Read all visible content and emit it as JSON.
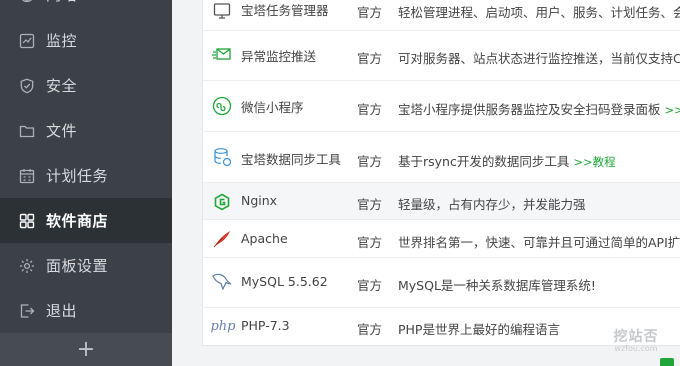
{
  "sidebar": {
    "items": [
      {
        "label": "网站",
        "icon": "globe-icon"
      },
      {
        "label": "监控",
        "icon": "monitor-icon"
      },
      {
        "label": "安全",
        "icon": "shield-icon"
      },
      {
        "label": "文件",
        "icon": "folder-icon"
      },
      {
        "label": "计划任务",
        "icon": "calendar-icon"
      },
      {
        "label": "软件商店",
        "icon": "grid-icon",
        "active": true
      },
      {
        "label": "面板设置",
        "icon": "gear-icon"
      },
      {
        "label": "退出",
        "icon": "logout-icon"
      }
    ],
    "add_label": "+"
  },
  "plugins": [
    {
      "name": "宝塔任务管理器",
      "type": "官方",
      "desc": "轻松管理进程、启动项、用户、服务、计划任务、会话",
      "icon": "task-manager-icon"
    },
    {
      "name": "异常监控推送",
      "type": "官方",
      "desc": "可对服务器、站点状态进行监控推送，当前仅支持Cen",
      "icon": "alert-push-icon"
    },
    {
      "name": "微信小程序",
      "type": "官方",
      "desc": "宝塔小程序提供服务器监控及安全扫码登录面板",
      "link": ">>教",
      "icon": "wechat-miniprogram-icon"
    },
    {
      "name": "宝塔数据同步工具",
      "type": "官方",
      "desc": "基于rsync开发的数据同步工具",
      "link": ">>教程",
      "icon": "database-sync-icon"
    },
    {
      "name": "Nginx",
      "type": "官方",
      "desc": "轻量级，占有内存少，并发能力强",
      "icon": "nginx-icon"
    },
    {
      "name": "Apache",
      "type": "官方",
      "desc": "世界排名第一，快速、可靠并且可通过简单的API扩充",
      "icon": "apache-feather-icon"
    },
    {
      "name": "MySQL 5.5.62",
      "type": "官方",
      "desc": "MySQL是一种关系数据库管理系统!",
      "icon": "mysql-dolphin-icon"
    },
    {
      "name": "PHP-7.3",
      "type": "官方",
      "desc": "PHP是世界上最好的编程语言",
      "icon": "php-icon",
      "icon_text": "php"
    }
  ],
  "watermark": {
    "top": "挖站否",
    "bottom": "wzfou.com"
  },
  "colors": {
    "sidebar": "#3c4147",
    "sidebar_active": "#2c3136",
    "accent_green": "#20a53a"
  }
}
